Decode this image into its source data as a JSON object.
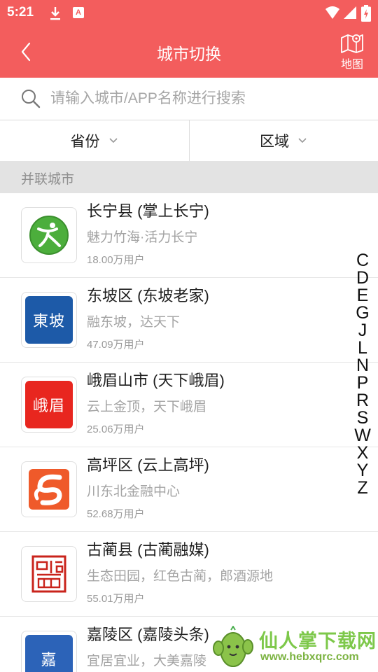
{
  "status_bar": {
    "time": "5:21",
    "app_badge": "A"
  },
  "app_bar": {
    "title": "城市切换",
    "map_label": "地图"
  },
  "search": {
    "placeholder": "请输入城市/APP名称进行搜索"
  },
  "filters": {
    "province": "省份",
    "region": "区域"
  },
  "section_header": "并联城市",
  "cities": [
    {
      "name": "长宁县 (掌上长宁)",
      "slogan": "魅力竹海·活力长宁",
      "users": "18.00万用户",
      "logo_icon": "changning-logo-icon"
    },
    {
      "name": "东坡区 (东坡老家)",
      "slogan": "融东坡，达天下",
      "users": "47.09万用户",
      "logo_icon": "dongpo-logo-icon",
      "logo_text": "東坡"
    },
    {
      "name": "峨眉山市 (天下峨眉)",
      "slogan": "云上金顶，天下峨眉",
      "users": "25.06万用户",
      "logo_icon": "emei-logo-icon",
      "logo_text": "峨眉"
    },
    {
      "name": "高坪区 (云上高坪)",
      "slogan": "川东北金融中心",
      "users": "52.68万用户",
      "logo_icon": "gaoping-logo-icon"
    },
    {
      "name": "古蔺县 (古蔺融媒)",
      "slogan": "生态田园，红色古蔺，郎酒源地",
      "users": "55.01万用户",
      "logo_icon": "gulin-logo-icon"
    },
    {
      "name": "嘉陵区 (嘉陵头条)",
      "slogan": "宜居宜业，大美嘉陵",
      "users": "",
      "logo_icon": "jialing-logo-icon",
      "logo_text": "嘉"
    }
  ],
  "alphabet_index": [
    "C",
    "D",
    "E",
    "G",
    "J",
    "L",
    "N",
    "P",
    "R",
    "S",
    "W",
    "X",
    "Y",
    "Z"
  ],
  "watermark": {
    "title": "仙人掌下载网",
    "url": "www.hebxqrc.com"
  },
  "colors": {
    "brand_red": "#f35d5d",
    "section_bg": "#e3e3e3",
    "muted_text": "#a3a3a3"
  }
}
